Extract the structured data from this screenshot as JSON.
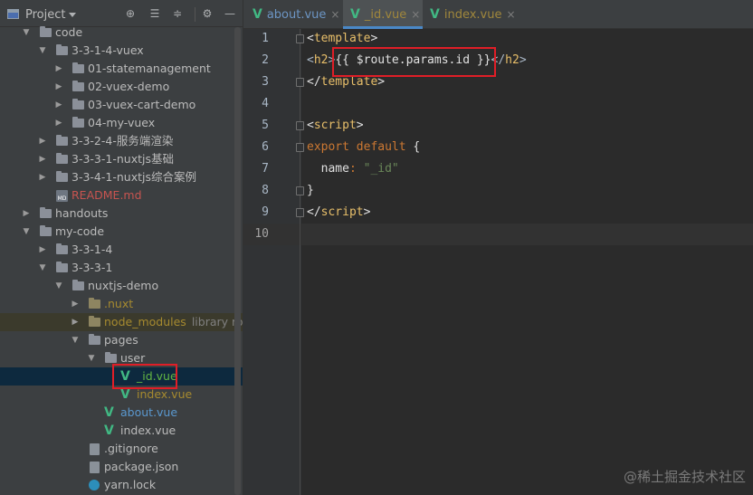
{
  "sidebar": {
    "title": "Project",
    "header_buttons": [
      "target-icon",
      "expand-all-icon",
      "collapse-all-icon",
      "gear-icon",
      "hide-icon"
    ],
    "tree": [
      {
        "label": "code",
        "type": "folder",
        "expanded": true
      },
      {
        "label": "3-3-1-4-vuex",
        "type": "folder",
        "expanded": true
      },
      {
        "label": "01-statemanagement",
        "type": "folder",
        "expanded": false
      },
      {
        "label": "02-vuex-demo",
        "type": "folder",
        "expanded": false
      },
      {
        "label": "03-vuex-cart-demo",
        "type": "folder",
        "expanded": false
      },
      {
        "label": "04-my-vuex",
        "type": "folder",
        "expanded": false
      },
      {
        "label": "3-3-2-4-服务端渲染",
        "type": "folder",
        "expanded": false
      },
      {
        "label": "3-3-3-1-nuxtjs基础",
        "type": "folder",
        "expanded": false
      },
      {
        "label": "3-3-4-1-nuxtjs综合案例",
        "type": "folder",
        "expanded": false
      },
      {
        "label": "README.md",
        "type": "markdown"
      },
      {
        "label": "handouts",
        "type": "folder",
        "expanded": false
      },
      {
        "label": "my-code",
        "type": "folder",
        "expanded": true
      },
      {
        "label": "3-3-1-4",
        "type": "folder",
        "expanded": false
      },
      {
        "label": "3-3-3-1",
        "type": "folder",
        "expanded": true
      },
      {
        "label": "nuxtjs-demo",
        "type": "folder",
        "expanded": true
      },
      {
        "label": ".nuxt",
        "type": "folder",
        "expanded": false
      },
      {
        "label": "node_modules",
        "type": "folder",
        "expanded": false,
        "tag": "library roo"
      },
      {
        "label": "pages",
        "type": "folder",
        "expanded": true
      },
      {
        "label": "user",
        "type": "folder",
        "expanded": true
      },
      {
        "label": "_id.vue",
        "type": "vue",
        "selected": true
      },
      {
        "label": "index.vue",
        "type": "vue"
      },
      {
        "label": "about.vue",
        "type": "vue"
      },
      {
        "label": "index.vue",
        "type": "vue"
      },
      {
        "label": ".gitignore",
        "type": "file"
      },
      {
        "label": "package.json",
        "type": "file"
      },
      {
        "label": "yarn.lock",
        "type": "yarn"
      }
    ]
  },
  "editor": {
    "tabs": [
      {
        "label": "about.vue",
        "active": false
      },
      {
        "label": "_id.vue",
        "active": true
      },
      {
        "label": "index.vue",
        "active": false
      }
    ],
    "line_numbers": [
      "1",
      "2",
      "3",
      "4",
      "5",
      "6",
      "7",
      "8",
      "9",
      "10"
    ],
    "code": {
      "l1_open": "<",
      "l1_tag": "template",
      "l1_close": ">",
      "l2_indent": "  ",
      "l2_open": "<",
      "l2_tag": "h2",
      "l2_close": ">",
      "l2_expr": "{{ $route.params.id }}",
      "l2_end_open": "</",
      "l2_end_tag": "h2",
      "l2_end_close": ">",
      "l3_open": "</",
      "l3_tag": "template",
      "l3_close": ">",
      "l5_open": "<",
      "l5_tag": "script",
      "l5_close": ">",
      "l6_kw1": "export",
      "l6_kw2": "default",
      "l6_brace": " {",
      "l7_key": "  name",
      "l7_colon": ": ",
      "l7_val": "\"_id\"",
      "l8_brace": "}",
      "l9_open": "</",
      "l9_tag": "script",
      "l9_close": ">"
    }
  },
  "watermark": "@稀土掘金技术社区",
  "colors": {
    "highlight_box": "#e01e27",
    "vue_green": "#41b883",
    "selection": "#0d293e"
  }
}
